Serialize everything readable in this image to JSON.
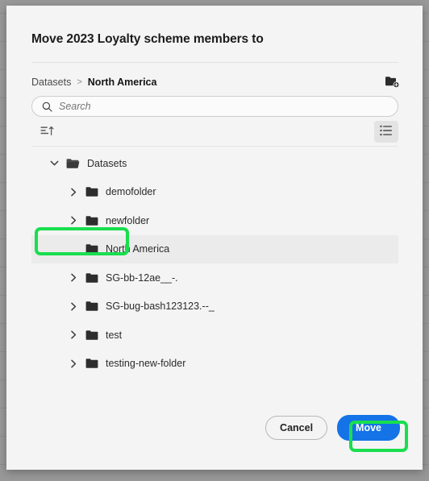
{
  "dialog": {
    "title": "Move 2023 Loyalty scheme members to",
    "breadcrumb": {
      "root_label": "Datasets",
      "separator": ">",
      "current_label": "North America"
    },
    "new_folder_icon": "new-folder-icon",
    "search": {
      "value": "",
      "placeholder": "Search",
      "icon": "search-icon"
    },
    "toolbar": {
      "sort_icon": "sort-ascending-icon",
      "view_icon": "list-view-icon"
    },
    "tree": [
      {
        "label": "Datasets",
        "indent": 0,
        "expanded": true,
        "twisty": "chevron-down-icon",
        "selected": false,
        "icon": "folder-open-icon"
      },
      {
        "label": "demofolder",
        "indent": 1,
        "expanded": false,
        "twisty": "chevron-right-icon",
        "selected": false,
        "icon": "folder-icon"
      },
      {
        "label": "newfolder",
        "indent": 1,
        "expanded": false,
        "twisty": "chevron-right-icon",
        "selected": false,
        "icon": "folder-icon"
      },
      {
        "label": "North America",
        "indent": 1,
        "expanded": false,
        "twisty": "none",
        "selected": true,
        "icon": "folder-icon"
      },
      {
        "label": "SG-bb-12ae__-.",
        "indent": 1,
        "expanded": false,
        "twisty": "chevron-right-icon",
        "selected": false,
        "icon": "folder-icon"
      },
      {
        "label": "SG-bug-bash123123.--_",
        "indent": 1,
        "expanded": false,
        "twisty": "chevron-right-icon",
        "selected": false,
        "icon": "folder-icon"
      },
      {
        "label": "test",
        "indent": 1,
        "expanded": false,
        "twisty": "chevron-right-icon",
        "selected": false,
        "icon": "folder-icon"
      },
      {
        "label": "testing-new-folder",
        "indent": 1,
        "expanded": false,
        "twisty": "chevron-right-icon",
        "selected": false,
        "icon": "folder-icon"
      }
    ],
    "footer": {
      "cancel_label": "Cancel",
      "move_label": "Move"
    }
  },
  "colors": {
    "accent_blue": "#1473e6",
    "annotation_green": "#19de4e",
    "modal_background": "#f4f4f4",
    "scrim": "#989898",
    "selected_row": "#ebebeb"
  },
  "annotations": [
    {
      "name": "north-america-folder-highlight"
    },
    {
      "name": "move-button-highlight"
    }
  ]
}
